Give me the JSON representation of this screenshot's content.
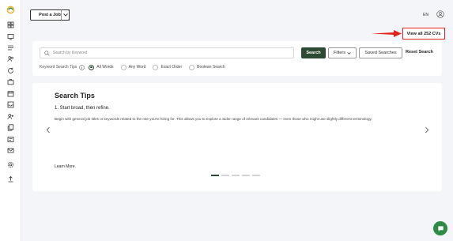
{
  "header": {
    "post_job_label": "Post a Job",
    "lang_label": "EN",
    "view_all_label": "View all 252 CVs"
  },
  "sidebar": {
    "items": [
      {
        "icon": "dashboard-icon"
      },
      {
        "icon": "monitor-icon"
      },
      {
        "icon": "list-icon"
      },
      {
        "icon": "users-icon"
      },
      {
        "icon": "refresh-icon"
      },
      {
        "icon": "briefcase-icon"
      },
      {
        "icon": "calendar-icon"
      },
      {
        "icon": "inbox-icon"
      },
      {
        "icon": "add-user-icon"
      },
      {
        "icon": "copy-icon"
      },
      {
        "icon": "id-card-icon"
      },
      {
        "icon": "mail-icon"
      },
      {
        "icon": "settings-icon"
      },
      {
        "icon": "upload-icon"
      }
    ]
  },
  "search": {
    "placeholder": "Search by Keyword",
    "search_label": "Search",
    "filters_label": "Filters",
    "saved_label": "Saved Searches",
    "reset_label": "Reset Search",
    "tips_label": "Keyword Search Tips",
    "modes": [
      {
        "label": "All Words",
        "selected": true
      },
      {
        "label": "Any Word",
        "selected": false
      },
      {
        "label": "Exact Order",
        "selected": false
      },
      {
        "label": "Boolean Search",
        "selected": false
      }
    ]
  },
  "tips": {
    "title": "Search Tips",
    "heading": "1. Start broad, then refine.",
    "body": "Begin with general job titles or keywords related to the role you're hiring for. This allows you to explore a wider range of relevant candidates — even those who might use slightly different terminology.",
    "learn_more": "Learn More.",
    "pages": 5,
    "active_page": 1
  },
  "colors": {
    "accent": "#2f4a32",
    "highlight": "#e2231a",
    "chat": "#2e8b45"
  }
}
